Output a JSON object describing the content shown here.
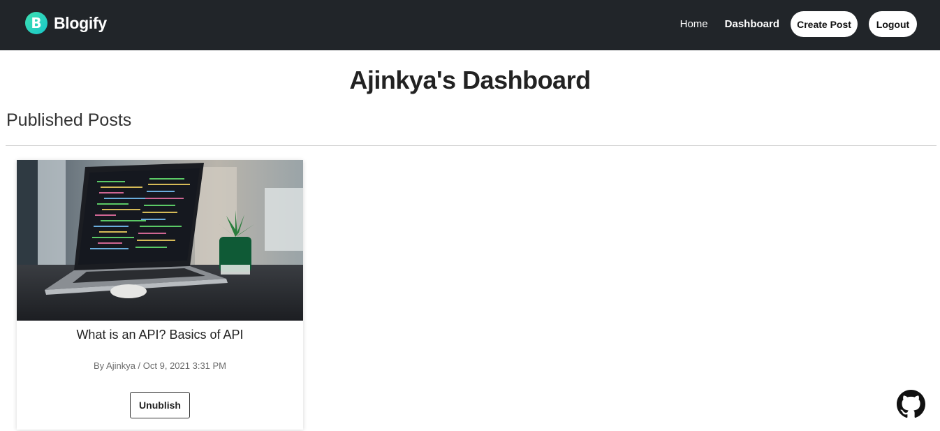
{
  "navbar": {
    "brand_letter": "B",
    "brand_name": "Blogify",
    "links": {
      "home": "Home",
      "dashboard": "Dashboard"
    },
    "create_post": "Create Post",
    "logout": "Logout"
  },
  "page": {
    "title": "Ajinkya's Dashboard",
    "section_heading": "Published Posts"
  },
  "posts": [
    {
      "image_icon": "laptop-with-code-photo",
      "title": "What is an API? Basics of API",
      "meta": "By Ajinkya / Oct 9, 2021 3:31 PM",
      "action_label": "Unublish"
    }
  ],
  "footer": {
    "github_icon": "github-icon"
  },
  "colors": {
    "navbar_bg": "#212529",
    "brand_accent": "#18c6c9",
    "page_bg": "#ffffff"
  }
}
